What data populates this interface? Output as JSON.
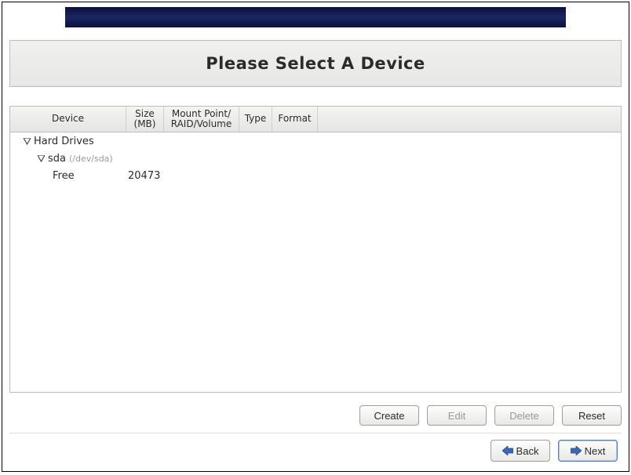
{
  "title": "Please Select A Device",
  "columns": {
    "device": "Device",
    "size": "Size\n(MB)",
    "mount": "Mount Point/\nRAID/Volume",
    "type": "Type",
    "format": "Format"
  },
  "tree": {
    "root_label": "Hard Drives",
    "disk": {
      "name": "sda",
      "path": "(/dev/sda)"
    },
    "free": {
      "label": "Free",
      "size_mb": "20473"
    }
  },
  "buttons": {
    "create": "Create",
    "edit": "Edit",
    "delete": "Delete",
    "reset": "Reset",
    "back": "Back",
    "next": "Next"
  }
}
